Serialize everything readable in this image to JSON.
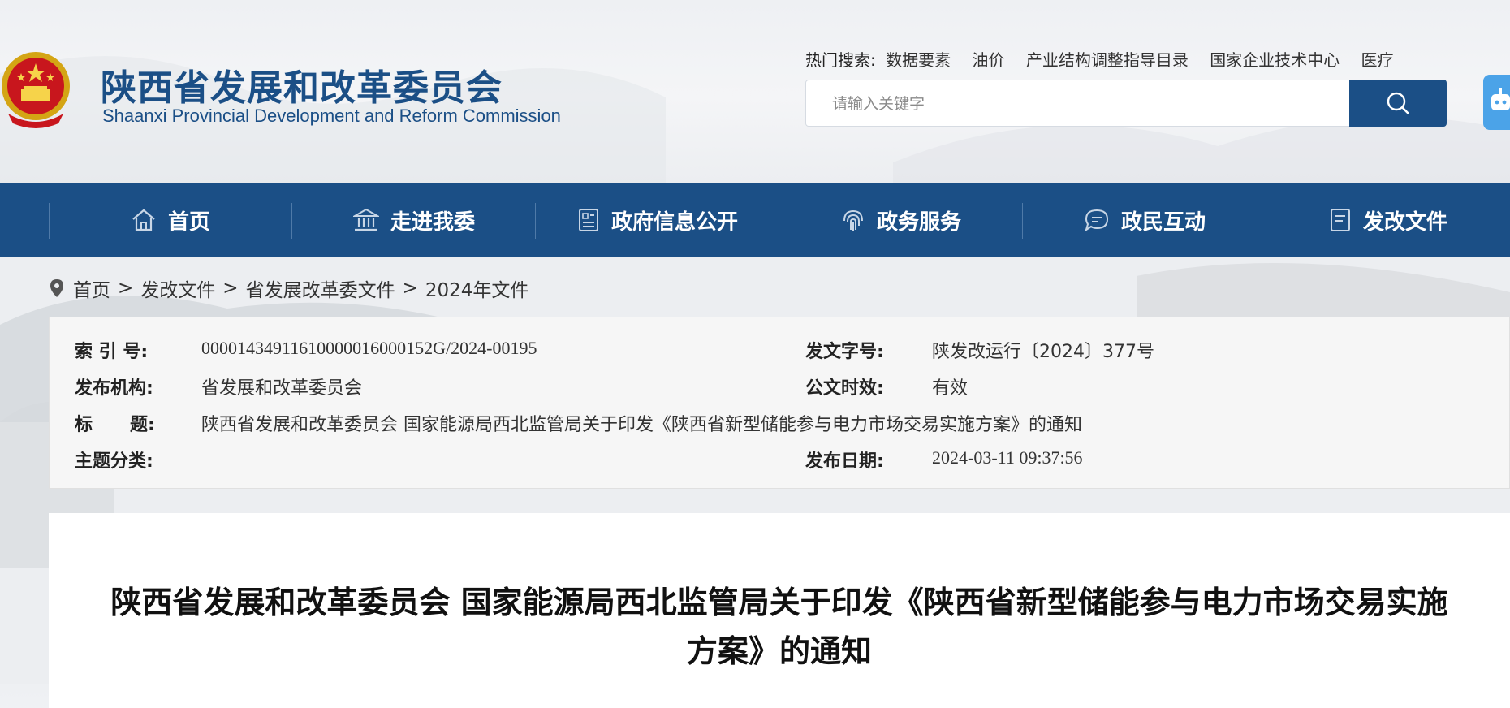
{
  "header": {
    "title_cn": "陕西省发展和改革委员会",
    "title_en": "Shaanxi Provincial Development and Reform Commission",
    "emblem_icon": "national-emblem-icon"
  },
  "hot_search": {
    "label": "热门搜索:",
    "items": [
      "数据要素",
      "油价",
      "产业结构调整指导目录",
      "国家企业技术中心",
      "医疗"
    ]
  },
  "search": {
    "placeholder": "请输入关键字",
    "button_icon": "search-icon"
  },
  "nav": {
    "items": [
      {
        "label": "首页",
        "icon": "home-icon"
      },
      {
        "label": "走进我委",
        "icon": "building-icon"
      },
      {
        "label": "政府信息公开",
        "icon": "document-list-icon"
      },
      {
        "label": "政务服务",
        "icon": "fingerprint-icon"
      },
      {
        "label": "政民互动",
        "icon": "chat-icon"
      },
      {
        "label": "发改文件",
        "icon": "file-icon"
      }
    ]
  },
  "breadcrumb": {
    "icon": "location-pin-icon",
    "items": [
      "首页",
      "发改文件",
      "省发展改革委文件",
      "2024年文件"
    ],
    "separator": ">"
  },
  "meta": {
    "index_label": "索 引 号:",
    "index_value": "00001434911610000016000152G/2024-00195",
    "doc_no_label": "发文字号:",
    "doc_no_value": "陕发改运行〔2024〕377号",
    "publisher_label": "发布机构:",
    "publisher_value": "省发展和改革委员会",
    "validity_label": "公文时效:",
    "validity_value": "有效",
    "title_label": "标      题:",
    "title_value": "陕西省发展和改革委员会 国家能源局西北监管局关于印发《陕西省新型储能参与电力市场交易实施方案》的通知",
    "category_label": "主题分类:",
    "category_value": "",
    "date_label": "发布日期:",
    "date_value": "2024-03-11 09:37:56"
  },
  "document": {
    "title": "陕西省发展和改革委员会 国家能源局西北监管局关于印发《陕西省新型储能参与电力市场交易实施方案》的通知"
  },
  "colors": {
    "primary": "#1b4f86",
    "robot_button": "#4ba3e8"
  }
}
